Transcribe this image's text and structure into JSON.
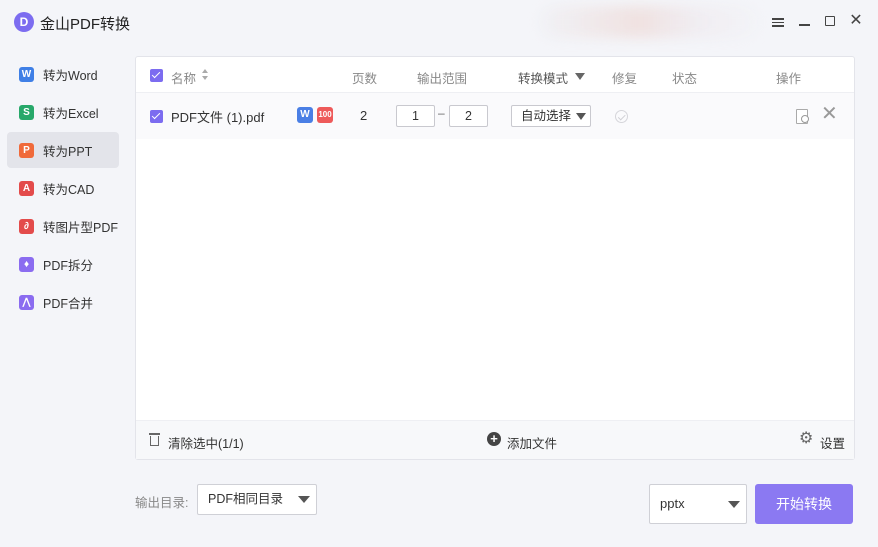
{
  "app": {
    "logo": "D",
    "title": "金山PDF转换"
  },
  "window_controls": [
    "menu-icon",
    "minimize-icon",
    "maximize-icon",
    "close-icon"
  ],
  "sidebar": {
    "items": [
      {
        "label": "转为Word",
        "icon": "W",
        "color": "#3f7fe6"
      },
      {
        "label": "转为Excel",
        "icon": "S",
        "color": "#27a86a"
      },
      {
        "label": "转为PPT",
        "icon": "P",
        "color": "#f06a3a",
        "active": true
      },
      {
        "label": "转为CAD",
        "icon": "A",
        "color": "#e34b4b"
      },
      {
        "label": "转图片型PDF",
        "icon": "∂",
        "color": "#e34b4b"
      },
      {
        "label": "PDF拆分",
        "icon": "♦",
        "color": "#8b6cf0"
      },
      {
        "label": "PDF合并",
        "icon": "⋀",
        "color": "#8b6cf0"
      }
    ]
  },
  "table": {
    "headers": {
      "name": "名称",
      "pages": "页数",
      "range": "输出范围",
      "mode": "转换模式",
      "repair": "修复",
      "status": "状态",
      "actions": "操作"
    },
    "rows": [
      {
        "checked": true,
        "file_name": "PDF文件 (1).pdf",
        "badge_w": "W",
        "badge_t": "100",
        "pages": "2",
        "range_from": "1",
        "range_sep": "–",
        "range_to": "2",
        "mode": "自动选择"
      }
    ]
  },
  "footer": {
    "clear_label": "清除选中(1/1)",
    "add_label": "添加文件",
    "settings_label": "设置"
  },
  "bottom": {
    "output_dir_label": "输出目录:",
    "output_dir_value": "PDF相同目录",
    "format_value": "pptx",
    "start_label": "开始转换"
  },
  "colors": {
    "accent": "#7c6cf0",
    "start_button": "#8b79f2"
  }
}
